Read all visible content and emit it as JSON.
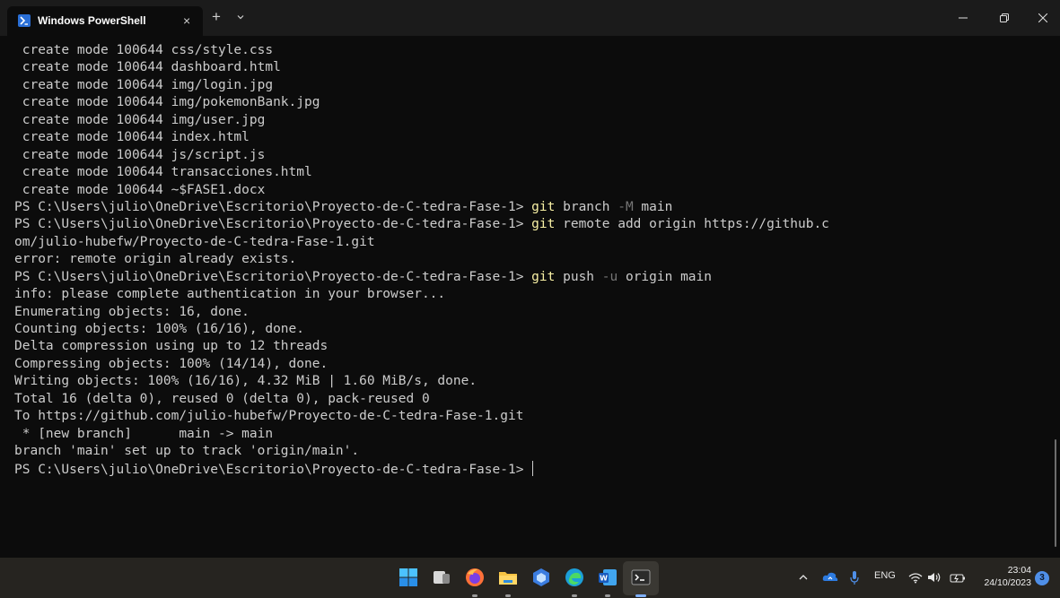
{
  "window": {
    "tab_title": "Windows PowerShell",
    "tab_close": "×",
    "new_tab": "+"
  },
  "icons": {
    "tab": "powershell-icon",
    "close_tab": "close-icon",
    "new_tab": "plus-icon",
    "dropdown": "chevron-down-icon",
    "minimize": "minimize-icon",
    "maximize": "restore-icon",
    "close_window": "close-icon"
  },
  "colors": {
    "terminal_bg": "#0c0c0c",
    "terminal_text": "#cccccc",
    "command": "#f9f1a5",
    "parameter": "#767676",
    "titlebar": "#1b1b1b",
    "taskbar": "#262420",
    "accent": "#4f8fe8"
  },
  "terminal": {
    "lines": [
      {
        "text": " create mode 100644 css/style.css"
      },
      {
        "text": " create mode 100644 dashboard.html"
      },
      {
        "text": " create mode 100644 img/login.jpg"
      },
      {
        "text": " create mode 100644 img/pokemonBank.jpg"
      },
      {
        "text": " create mode 100644 img/user.jpg"
      },
      {
        "text": " create mode 100644 index.html"
      },
      {
        "text": " create mode 100644 js/script.js"
      },
      {
        "text": " create mode 100644 transacciones.html"
      },
      {
        "text": " create mode 100644 ~$FASE1.docx"
      },
      {
        "prompt": "PS C:\\Users\\julio\\OneDrive\\Escritorio\\Proyecto-de-C-tedra-Fase-1> ",
        "cmd": "git",
        "args": [
          " branch ",
          "-M",
          " main"
        ]
      },
      {
        "prompt": "PS C:\\Users\\julio\\OneDrive\\Escritorio\\Proyecto-de-C-tedra-Fase-1> ",
        "cmd": "git",
        "args": [
          " remote add origin https://github.c",
          "",
          ""
        ]
      },
      {
        "text": "om/julio-hubefw/Proyecto-de-C-tedra-Fase-1.git"
      },
      {
        "text": "error: remote origin already exists."
      },
      {
        "prompt": "PS C:\\Users\\julio\\OneDrive\\Escritorio\\Proyecto-de-C-tedra-Fase-1> ",
        "cmd": "git",
        "args": [
          " push ",
          "-u",
          " origin main"
        ]
      },
      {
        "text": "info: please complete authentication in your browser..."
      },
      {
        "text": "Enumerating objects: 16, done."
      },
      {
        "text": "Counting objects: 100% (16/16), done."
      },
      {
        "text": "Delta compression using up to 12 threads"
      },
      {
        "text": "Compressing objects: 100% (14/14), done."
      },
      {
        "text": "Writing objects: 100% (16/16), 4.32 MiB | 1.60 MiB/s, done."
      },
      {
        "text": "Total 16 (delta 0), reused 0 (delta 0), pack-reused 0"
      },
      {
        "text": "To https://github.com/julio-hubefw/Proyecto-de-C-tedra-Fase-1.git"
      },
      {
        "text": " * [new branch]      main -> main"
      },
      {
        "text": "branch 'main' set up to track 'origin/main'."
      },
      {
        "prompt": "PS C:\\Users\\julio\\OneDrive\\Escritorio\\Proyecto-de-C-tedra-Fase-1> ",
        "cursor": true
      }
    ]
  },
  "taskbar": {
    "apps": [
      {
        "name": "start-button",
        "icon": "windows-logo-icon"
      },
      {
        "name": "taskbar-app-1",
        "icon": "app-window-icon"
      },
      {
        "name": "taskbar-firefox",
        "icon": "firefox-icon"
      },
      {
        "name": "taskbar-file-explorer",
        "icon": "folder-icon"
      },
      {
        "name": "taskbar-app-5",
        "icon": "hexagon-app-icon"
      },
      {
        "name": "taskbar-edge",
        "icon": "edge-icon"
      },
      {
        "name": "taskbar-word",
        "icon": "word-icon"
      },
      {
        "name": "taskbar-terminal",
        "icon": "terminal-icon"
      }
    ],
    "tray": {
      "language": "ENG",
      "time": "23:04",
      "date": "24/10/2023",
      "notifications": "3"
    }
  }
}
